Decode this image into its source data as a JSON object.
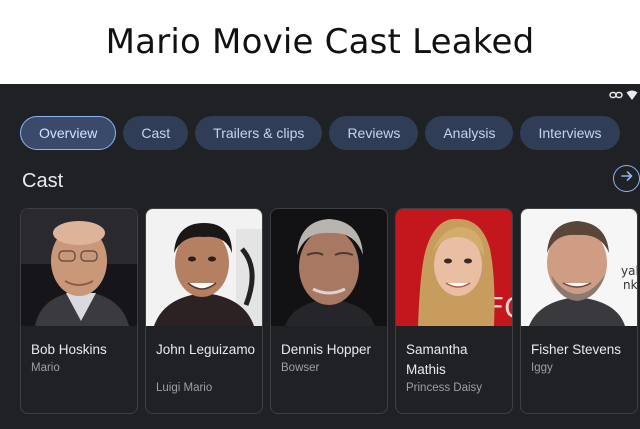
{
  "meme_title": "Mario Movie Cast Leaked",
  "tabs": [
    {
      "label": "Overview",
      "active": true
    },
    {
      "label": "Cast",
      "active": false
    },
    {
      "label": "Trailers & clips",
      "active": false
    },
    {
      "label": "Reviews",
      "active": false
    },
    {
      "label": "Analysis",
      "active": false
    },
    {
      "label": "Interviews",
      "active": false
    }
  ],
  "section": {
    "title": "Cast",
    "more_icon": "arrow-right-icon"
  },
  "cast": [
    {
      "name": "Bob Hoskins",
      "role": "Mario"
    },
    {
      "name": "John Leguizamo",
      "role": "Luigi Mario"
    },
    {
      "name": "Dennis Hopper",
      "role": "Bowser"
    },
    {
      "name": "Samantha Mathis",
      "role": "Princess Daisy"
    },
    {
      "name": "Fisher Stevens",
      "role": "Iggy"
    }
  ],
  "photo_backdrop_text": {
    "card4": "FO",
    "card5_line1": "yal",
    "card5_line2": "nk"
  },
  "colors": {
    "background": "#202124",
    "chip_background": "#2f3d57",
    "chip_text": "#c5d4f3",
    "accent": "#8ab4f8",
    "card_border": "#3c4043",
    "secondary_text": "#9aa0a6"
  }
}
